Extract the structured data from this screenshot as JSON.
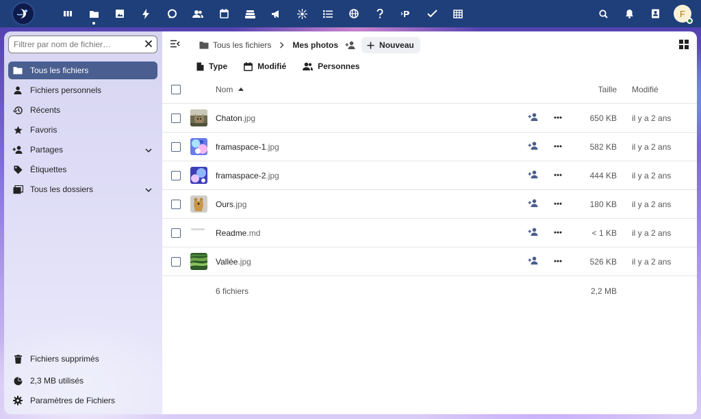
{
  "topbar": {
    "apps": [
      {
        "icon": "dashboard-icon",
        "active": false
      },
      {
        "icon": "folder-icon",
        "active": true
      },
      {
        "icon": "photos-icon",
        "active": false
      },
      {
        "icon": "activity-icon",
        "active": false
      },
      {
        "icon": "talk-icon",
        "active": false
      },
      {
        "icon": "contacts-icon",
        "active": false
      },
      {
        "icon": "calendar-icon",
        "active": false
      },
      {
        "icon": "deck-icon",
        "active": false
      },
      {
        "icon": "announcements-icon",
        "active": false
      },
      {
        "icon": "circles-icon",
        "active": false
      },
      {
        "icon": "tasks-list-icon",
        "active": false
      },
      {
        "icon": "globe-icon",
        "active": false
      },
      {
        "icon": "help-icon",
        "active": false
      },
      {
        "icon": "polls-icon",
        "active": false
      },
      {
        "icon": "checkmark-icon",
        "active": false
      },
      {
        "icon": "table-icon",
        "active": false
      }
    ],
    "avatar_initial": "F"
  },
  "sidebar": {
    "filter_placeholder": "Filtrer par nom de fichier…",
    "items": [
      {
        "label": "Tous les fichiers",
        "icon": "folder-icon",
        "active": true
      },
      {
        "label": "Fichiers personnels",
        "icon": "user-icon",
        "active": false
      },
      {
        "label": "Récents",
        "icon": "history-icon",
        "active": false
      },
      {
        "label": "Favoris",
        "icon": "star-icon",
        "active": false
      },
      {
        "label": "Partages",
        "icon": "share-icon",
        "active": false,
        "expandable": true
      },
      {
        "label": "Étiquettes",
        "icon": "tag-icon",
        "active": false
      },
      {
        "label": "Tous les dossiers",
        "icon": "folders-icon",
        "active": false,
        "expandable": true
      }
    ],
    "bottom": {
      "trash": "Fichiers supprimés",
      "quota": "2,3 MB utilisés",
      "settings": "Paramètres de Fichiers"
    }
  },
  "main": {
    "breadcrumb": {
      "root": "Tous les fichiers",
      "current": "Mes photos"
    },
    "new_button": "Nouveau",
    "filters": {
      "type": "Type",
      "modified": "Modifié",
      "people": "Personnes"
    },
    "columns": {
      "name": "Nom",
      "size": "Taille",
      "modified": "Modifié"
    },
    "files": [
      {
        "base": "Chaton",
        "ext": ".jpg",
        "size": "650 KB",
        "modified": "il y a 2 ans",
        "thumb": "cat"
      },
      {
        "base": "framaspace-1",
        "ext": ".jpg",
        "size": "582 KB",
        "modified": "il y a 2 ans",
        "thumb": "space1"
      },
      {
        "base": "framaspace-2",
        "ext": ".jpg",
        "size": "444 KB",
        "modified": "il y a 2 ans",
        "thumb": "space2"
      },
      {
        "base": "Ours",
        "ext": ".jpg",
        "size": "180 KB",
        "modified": "il y a 2 ans",
        "thumb": "bear"
      },
      {
        "base": "Readme",
        "ext": ".md",
        "size": "< 1 KB",
        "modified": "il y a 2 ans",
        "thumb": "text"
      },
      {
        "base": "Vallée",
        "ext": ".jpg",
        "size": "526 KB",
        "modified": "il y a 2 ans",
        "thumb": "valley"
      }
    ],
    "footer": {
      "count": "6 fichiers",
      "total": "2,2 MB"
    }
  }
}
